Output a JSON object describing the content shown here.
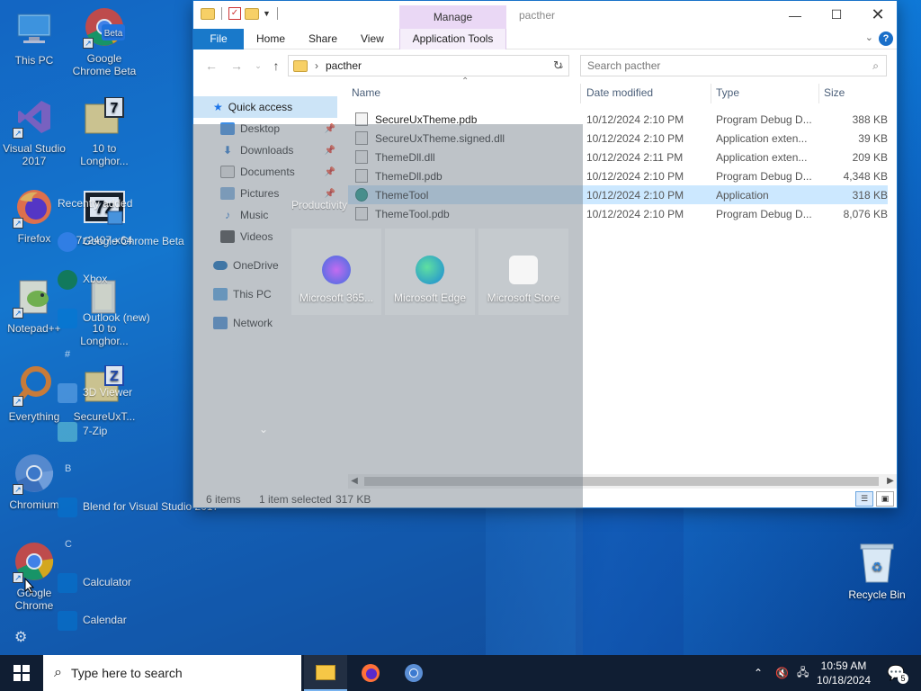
{
  "desktop": {
    "icons": [
      {
        "label": "This PC"
      },
      {
        "label": "Google Chrome Beta"
      },
      {
        "label": "Visual Studio 2017"
      },
      {
        "label": "10 to Longhor..."
      },
      {
        "label": "Firefox"
      },
      {
        "label": "7z2407-x64"
      },
      {
        "label": "Notepad++"
      },
      {
        "label": "10 to Longhor..."
      },
      {
        "label": "Everything"
      },
      {
        "label": "SecureUxT..."
      },
      {
        "label": "Chromium"
      },
      {
        "label": "Google Chrome"
      },
      {
        "label": "Recycle Bin"
      }
    ],
    "chrome_beta_badge": "Beta"
  },
  "start_overlay": {
    "recent_label": "Recently added",
    "items": [
      "Google Chrome Beta",
      "Xbox",
      "Outlook (new)",
      "3D Viewer",
      "7-Zip",
      "Blend for Visual Studio 2017",
      "Calculator",
      "Calendar"
    ],
    "letters": [
      "#",
      "B",
      "C"
    ],
    "productivity_label": "Productivity",
    "tiles": [
      "Microsoft 365...",
      "Microsoft Edge",
      "Microsoft Store"
    ]
  },
  "explorer": {
    "title": "pacther",
    "manage_tab": "Manage",
    "ribbon_tabs": [
      "File",
      "Home",
      "Share",
      "View",
      "Application Tools"
    ],
    "address_path": "pacther",
    "search_placeholder": "Search pacther",
    "nav": {
      "quick_access": "Quick access",
      "items": [
        "Desktop",
        "Downloads",
        "Documents",
        "Pictures",
        "Music",
        "Videos"
      ],
      "onedrive": "OneDrive",
      "this_pc": "This PC",
      "network": "Network"
    },
    "columns": [
      "Name",
      "Date modified",
      "Type",
      "Size"
    ],
    "files": [
      {
        "name": "SecureUxTheme.pdb",
        "date": "10/12/2024 2:10 PM",
        "type": "Program Debug D...",
        "size": "388 KB"
      },
      {
        "name": "SecureUxTheme.signed.dll",
        "date": "10/12/2024 2:10 PM",
        "type": "Application exten...",
        "size": "39 KB"
      },
      {
        "name": "ThemeDll.dll",
        "date": "10/12/2024 2:11 PM",
        "type": "Application exten...",
        "size": "209 KB"
      },
      {
        "name": "ThemeDll.pdb",
        "date": "10/12/2024 2:10 PM",
        "type": "Program Debug D...",
        "size": "4,348 KB"
      },
      {
        "name": "ThemeTool",
        "date": "10/12/2024 2:10 PM",
        "type": "Application",
        "size": "318 KB"
      },
      {
        "name": "ThemeTool.pdb",
        "date": "10/12/2024 2:10 PM",
        "type": "Program Debug D...",
        "size": "8,076 KB"
      }
    ],
    "status": {
      "items": "6 items",
      "selected": "1 item selected",
      "selected_size": "317 KB"
    }
  },
  "taskbar": {
    "search_placeholder": "Type here to search",
    "time": "10:59 AM",
    "date": "10/18/2024",
    "notification_count": "5"
  },
  "colors": {
    "accent": "#1979ca",
    "selection": "#cce8ff",
    "manage_tab": "#ead8f5",
    "taskbar": "#101e33"
  }
}
